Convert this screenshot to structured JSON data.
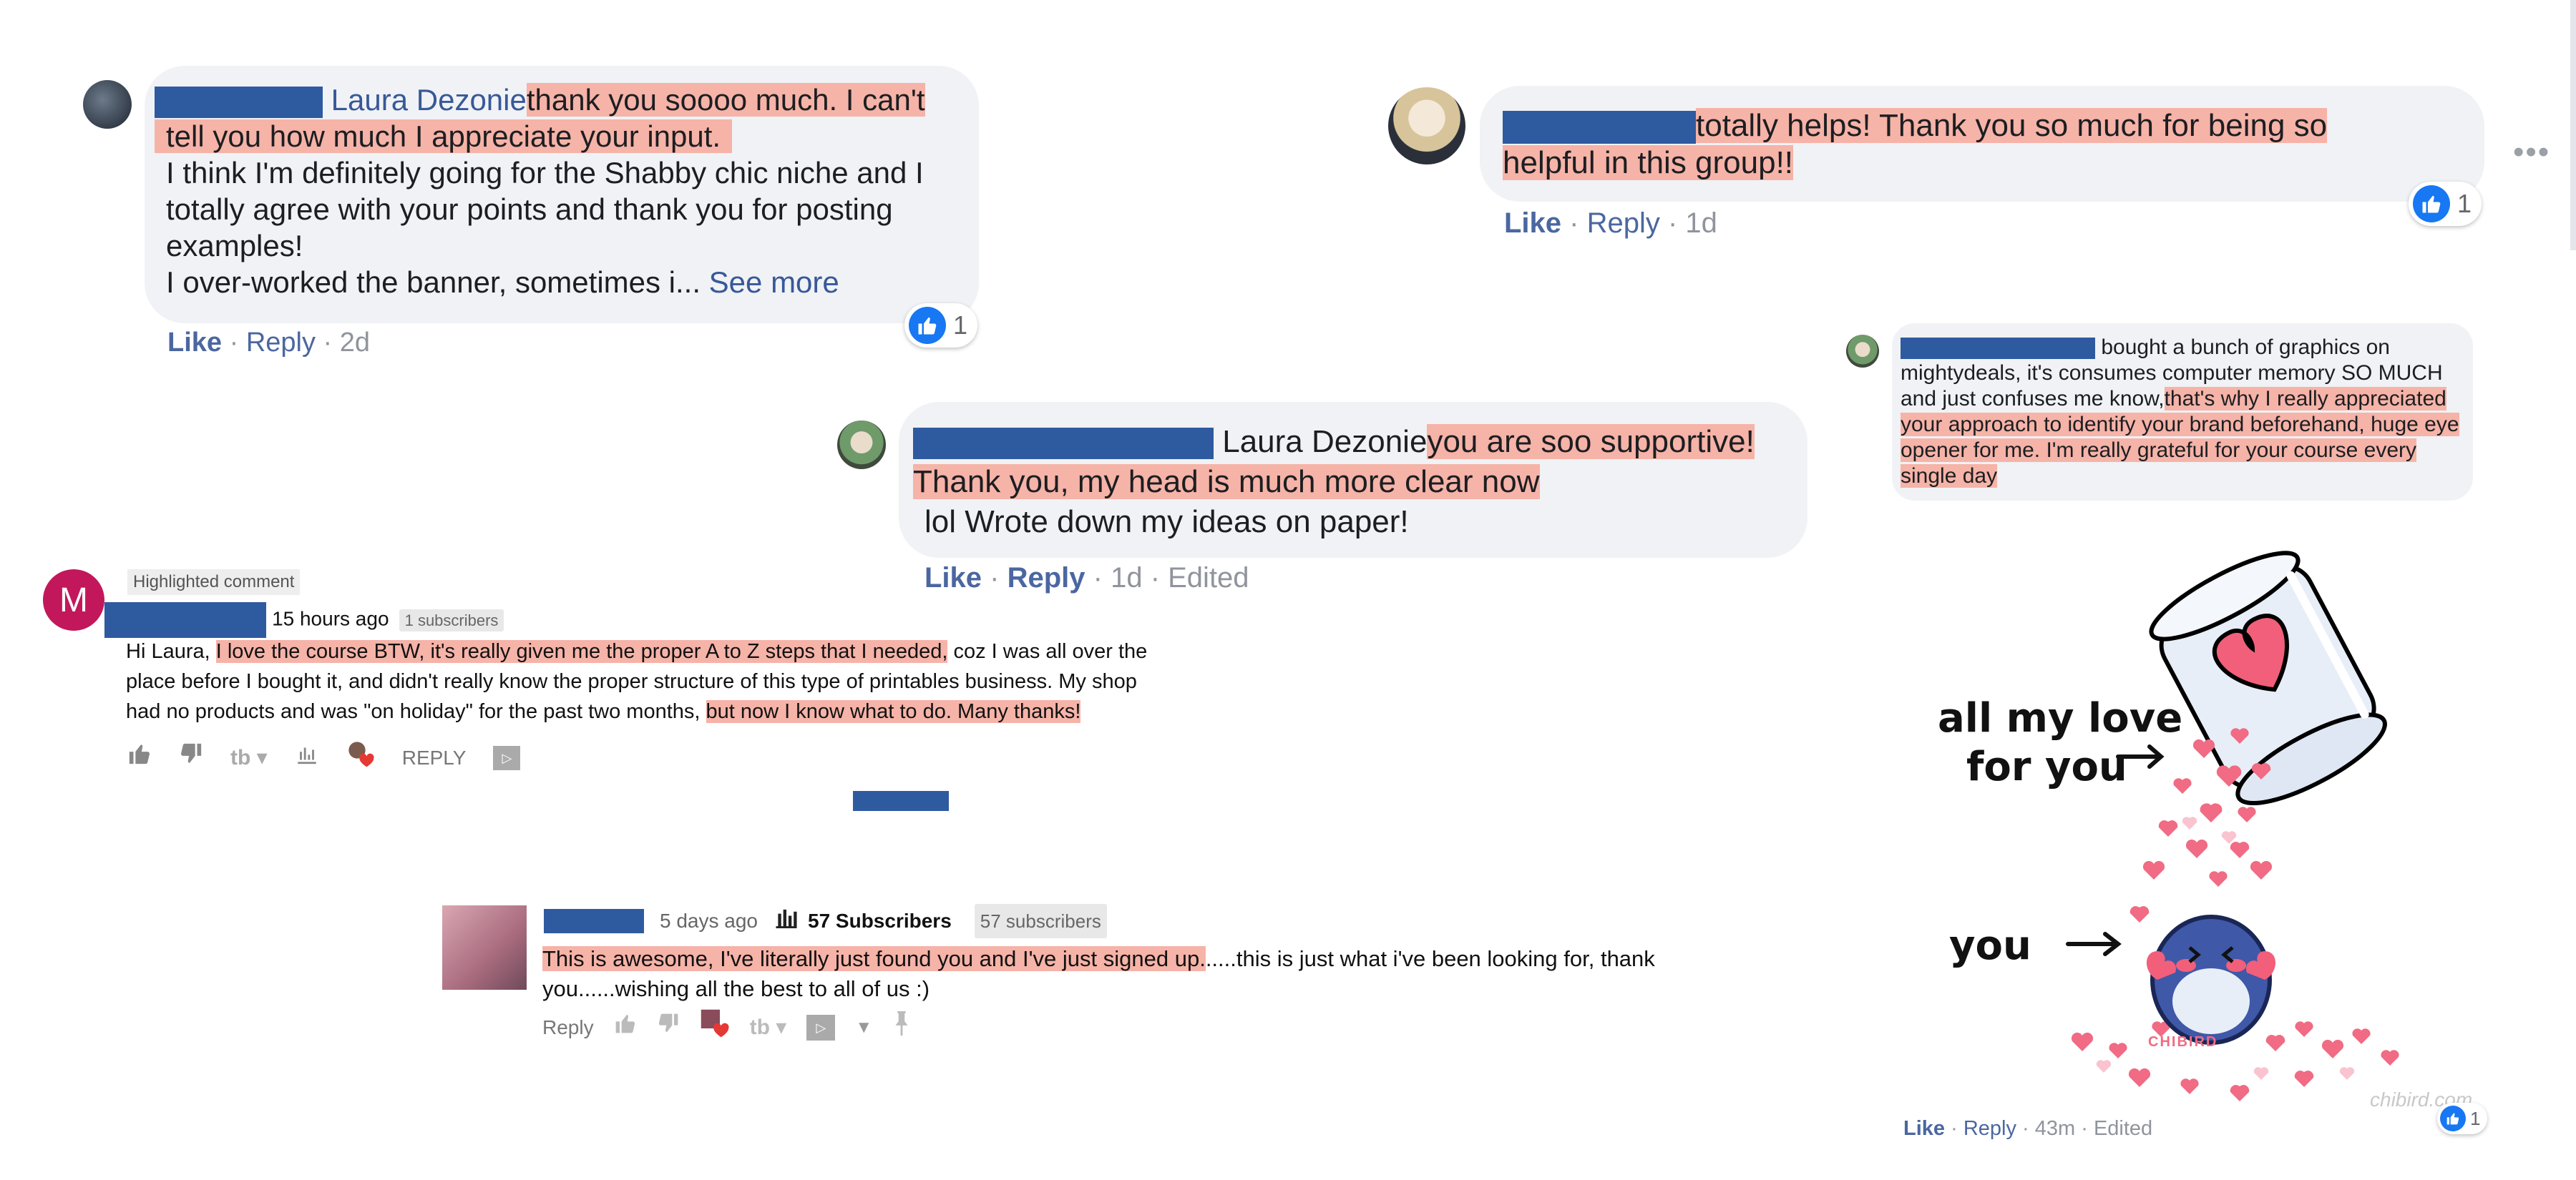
{
  "colors": {
    "highlight": "#f6b3a8",
    "fb_blue": "#385898",
    "redaction": "#2e5aa0",
    "bubble": "#f0f2f5"
  },
  "c1": {
    "name": "Laura Dezonie",
    "hl1": "thank you soooo much. I can't",
    "hl2": "tell you how much I appreciate your input.",
    "body": "I think I'm definitely going for the Shabby chic niche and I totally agree with your points and thank you for posting examples!",
    "line4": "I over-worked the banner, sometimes i...",
    "see_more": "See more",
    "like": "Like",
    "reply": "Reply",
    "time": "2d",
    "reactions": "1"
  },
  "c2": {
    "hl": "totally helps! Thank you so much for being so helpful in this group!!",
    "like": "Like",
    "reply": "Reply",
    "time": "1d",
    "reactions": "1"
  },
  "c3": {
    "name": "Laura Dezonie",
    "hl": "you are soo supportive! Thank you, my head is much more clear now",
    "tail": "lol Wrote down my ideas on paper!",
    "like": "Like",
    "reply": "Reply",
    "time": "1d",
    "edited": "Edited"
  },
  "c4": {
    "plain": "bought a bunch of graphics on mightydeals, it's consumes computer memory SO MUCH and just confuses me know,",
    "hl": "that's why I really appreciated your approach to identify your brand beforehand, huge eye opener for me. I'm really grateful for your course every single day"
  },
  "yt1": {
    "avatar_letter": "M",
    "highlighted": "Highlighted comment",
    "time": "15 hours ago",
    "subs": "1 subscribers",
    "p1": "Hi Laura,",
    "hl1": "I love the course BTW, it's really given me the proper A to Z steps that I needed,",
    "p2": "coz I was all over the place before I bought it, and didn't really know the proper structure of this type of printables business. My shop had no products and was \"on holiday\" for the past two months,",
    "hl2": "but now I know what to do. Many thanks!",
    "reply": "REPLY"
  },
  "yt2": {
    "time": "5 days ago",
    "subs_count": "57 Subscribers",
    "subs_badge": "57 subscribers",
    "hl": "This is awesome, I've literally just found you and I've just signed up.",
    "rest": ".....this is just what i've been looking for, thank you......wishing all the best to all of us :)",
    "reply": "Reply"
  },
  "art": {
    "caption1": "all my love",
    "caption2": "for you",
    "caption3": "you",
    "brand": "CHIBIRD",
    "watermark": "chibird.com",
    "like": "Like",
    "reply": "Reply",
    "time": "43m",
    "edited": "Edited",
    "reactions": "1"
  },
  "icons": [
    "thumbs-up-icon",
    "more-options-icon",
    "thumbs-down-icon",
    "bar-chart-icon",
    "pin-icon",
    "heart-icon"
  ]
}
